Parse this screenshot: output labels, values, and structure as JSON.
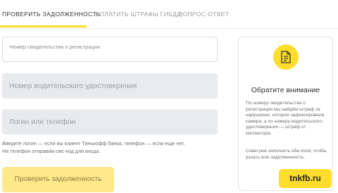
{
  "tabs": [
    {
      "label": "ПРОВЕРИТЬ ЗАДОЛЖЕННОСТЬ",
      "active": true
    },
    {
      "label": "ОПЛАТИТЬ ШТРАФЫ ГИБДД",
      "active": false
    },
    {
      "label": "ВОПРОС-ОТВЕТ",
      "active": false
    }
  ],
  "form": {
    "registration_label": "Номер свидетельства о регистрации",
    "license_placeholder": "Номер водительского удостоверения",
    "login_placeholder": "Логин или телефон",
    "hint_line1": "Введите логин — если вы клиент Тинькофф банка, телефон — если еще нет.",
    "hint_line2": "На телефон отправим смс-код для входа.",
    "submit_label": "Проверить задолженность"
  },
  "notice": {
    "icon": "document-icon",
    "title": "Обратите внимание",
    "text1": "По номеру свидетельства о регистрации мы найдём штраф за нарушение, которое зафиксировала камера, а по номеру водительского удостоверения — штраф от инспектора.",
    "text2": "Советуем заполнить оба поля, чтобы узнать всю задолженность."
  },
  "watermark": "tnkfb.ru",
  "colors": {
    "accent": "#ffdd2d",
    "field_bg": "#e8eaee"
  }
}
